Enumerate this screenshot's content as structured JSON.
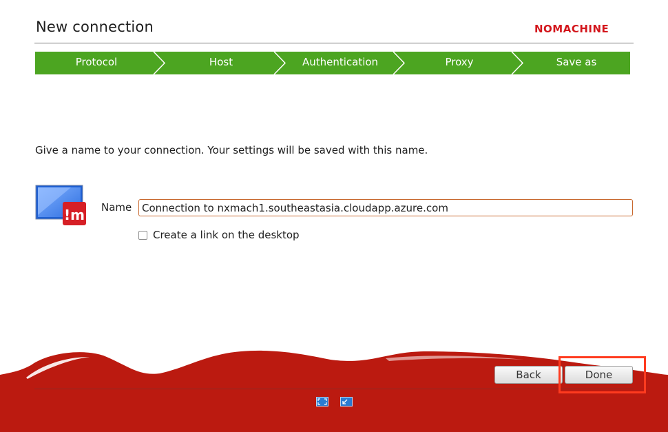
{
  "header": {
    "title": "New connection",
    "brand": "NOMACHINE"
  },
  "steps": [
    {
      "label": "Protocol"
    },
    {
      "label": "Host"
    },
    {
      "label": "Authentication"
    },
    {
      "label": "Proxy"
    },
    {
      "label": "Save as"
    }
  ],
  "instruction": "Give a name to your connection. Your settings will be saved with this name.",
  "form": {
    "name_label": "Name",
    "name_value": "Connection to nxmach1.southeastasia.cloudapp.azure.com",
    "link_label": "Create a link on the desktop",
    "link_checked": false
  },
  "buttons": {
    "back": "Back",
    "done": "Done"
  },
  "footer_icons": [
    "fullscreen-icon",
    "minimize-window-icon"
  ],
  "colors": {
    "step_green": "#4ca521",
    "brand_red": "#d3161c",
    "footer_red": "#bb1a10",
    "highlight": "#ff3b1f"
  }
}
